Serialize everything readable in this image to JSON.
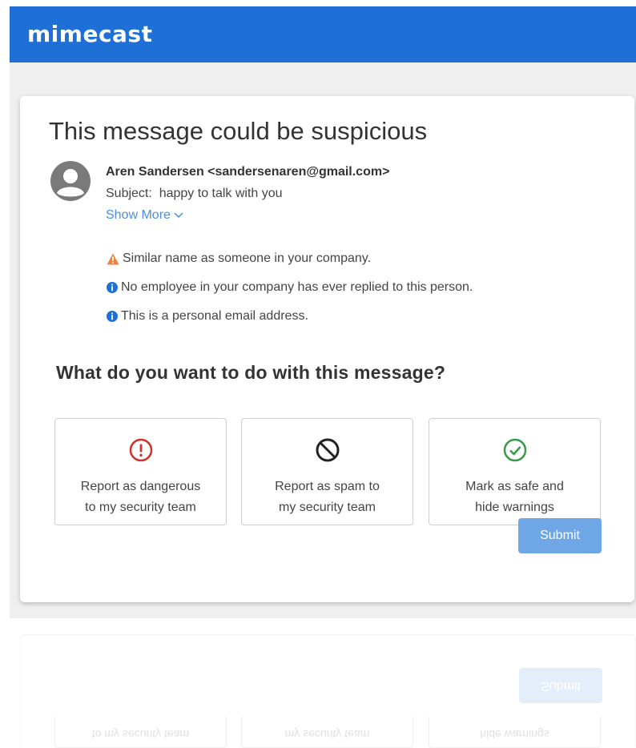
{
  "header": {
    "logo_text": "mimecast",
    "color": "#1e6fd6"
  },
  "card": {
    "title": "This message could be suspicious",
    "sender": {
      "avatar_icon": "user-avatar-icon",
      "display": "Aren Sandersen <sandersenaren@gmail.com>",
      "subject_label": "Subject:",
      "subject": "happy to talk with you",
      "show_more": "Show More"
    },
    "warnings": [
      {
        "icon": "warning-triangle-icon",
        "color": "#f0813a",
        "text": "Similar name as someone in your company."
      },
      {
        "icon": "info-circle-icon",
        "color": "#1e6fd6",
        "text": "No employee in your company has ever replied to this person."
      },
      {
        "icon": "info-circle-icon",
        "color": "#1e6fd6",
        "text": "This is a personal email address."
      }
    ],
    "question": "What do you want to do with this message?",
    "options": [
      {
        "icon": "exclamation-circle-icon",
        "color": "#d0312d",
        "line1": "Report as dangerous",
        "line2": "to my security team"
      },
      {
        "icon": "block-icon",
        "color": "#222222",
        "line1": "Report as spam to",
        "line2": "my security team"
      },
      {
        "icon": "check-circle-icon",
        "color": "#3a9a4a",
        "line1": "Mark as safe and",
        "line2": "hide warnings"
      }
    ],
    "submit_label": "Submit"
  }
}
